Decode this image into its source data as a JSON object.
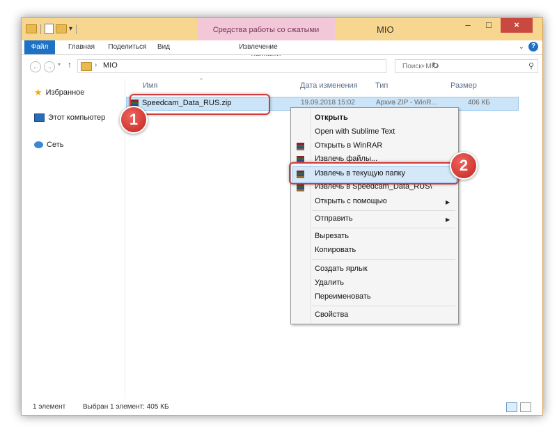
{
  "window": {
    "title": "MIO",
    "context_tab_title": "Средства работы со сжатыми папками",
    "controls": {
      "minimize": "–",
      "maximize": "□",
      "close": "×"
    }
  },
  "ribbon": {
    "tabs": [
      "Файл",
      "Главная",
      "Поделиться",
      "Вид",
      "Извлечение"
    ],
    "help": "?",
    "expand": "⌄"
  },
  "address": {
    "path": "MIO",
    "separator": "›",
    "search_placeholder": "Поиск: MIO"
  },
  "nav_pane": {
    "items": [
      "Избранное",
      "Этот компьютер",
      "Сеть"
    ]
  },
  "columns": {
    "name": "Имя",
    "date": "Дата изменения",
    "type": "Тип",
    "size": "Размер"
  },
  "file": {
    "name": "Speedcam_Data_RUS.zip",
    "date": "19.09.2018 15:02",
    "type": "Архив ZIP - WinR...",
    "size": "406 КБ"
  },
  "context_menu": {
    "items": [
      "Открыть",
      "Open with Sublime Text",
      "Открыть в WinRAR",
      "Извлечь файлы...",
      "Извлечь в текущую папку",
      "Извлечь в Speedcam_Data_RUS\\",
      "Открыть с помощью",
      "Отправить",
      "Вырезать",
      "Копировать",
      "Создать ярлык",
      "Удалить",
      "Переименовать",
      "Свойства"
    ]
  },
  "annotations": {
    "badge1": "1",
    "badge2": "2",
    "highlight_color": "#d23b3b"
  },
  "status": {
    "count": "1 элемент",
    "selected": "Выбран 1 элемент: 405 КБ"
  }
}
